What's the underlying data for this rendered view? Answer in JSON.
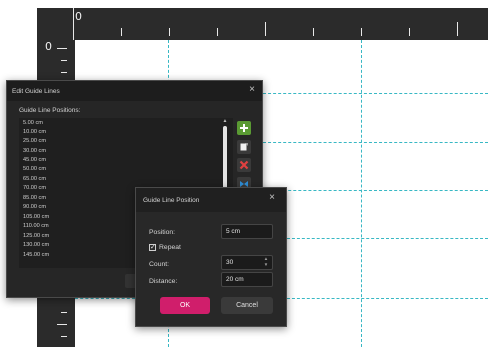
{
  "ruler": {
    "top_zero": "0",
    "left_zero": "0"
  },
  "edit_dialog": {
    "title": "Edit Guide Lines",
    "close_glyph": "×",
    "list_label": "Guide Line Positions:",
    "positions": [
      "5.00 cm",
      "10.00 cm",
      "25.00 cm",
      "30.00 cm",
      "45.00 cm",
      "50.00 cm",
      "65.00 cm",
      "70.00 cm",
      "85.00 cm",
      "90.00 cm",
      "105.00 cm",
      "110.00 cm",
      "125.00 cm",
      "130.00 cm",
      "145.00 cm"
    ],
    "buttons": {
      "add_icon": "plus-icon",
      "edit_icon": "edit-icon",
      "delete_icon": "delete-icon",
      "sort_icon": "sort-icon"
    }
  },
  "position_dialog": {
    "title": "Guide Line Position",
    "close_glyph": "×",
    "position_label": "Position:",
    "position_value": "5 cm",
    "repeat_label": "Repeat",
    "repeat_checked": "✓",
    "count_label": "Count:",
    "count_value": "30",
    "distance_label": "Distance:",
    "distance_value": "20 cm",
    "ok_label": "OK",
    "cancel_label": "Cancel"
  },
  "colors": {
    "accent": "#d01e6b",
    "guide": "#38b8c4",
    "add_green": "#5a9a33",
    "delete_red": "#e04040",
    "sort_blue": "#2f8fd8"
  }
}
